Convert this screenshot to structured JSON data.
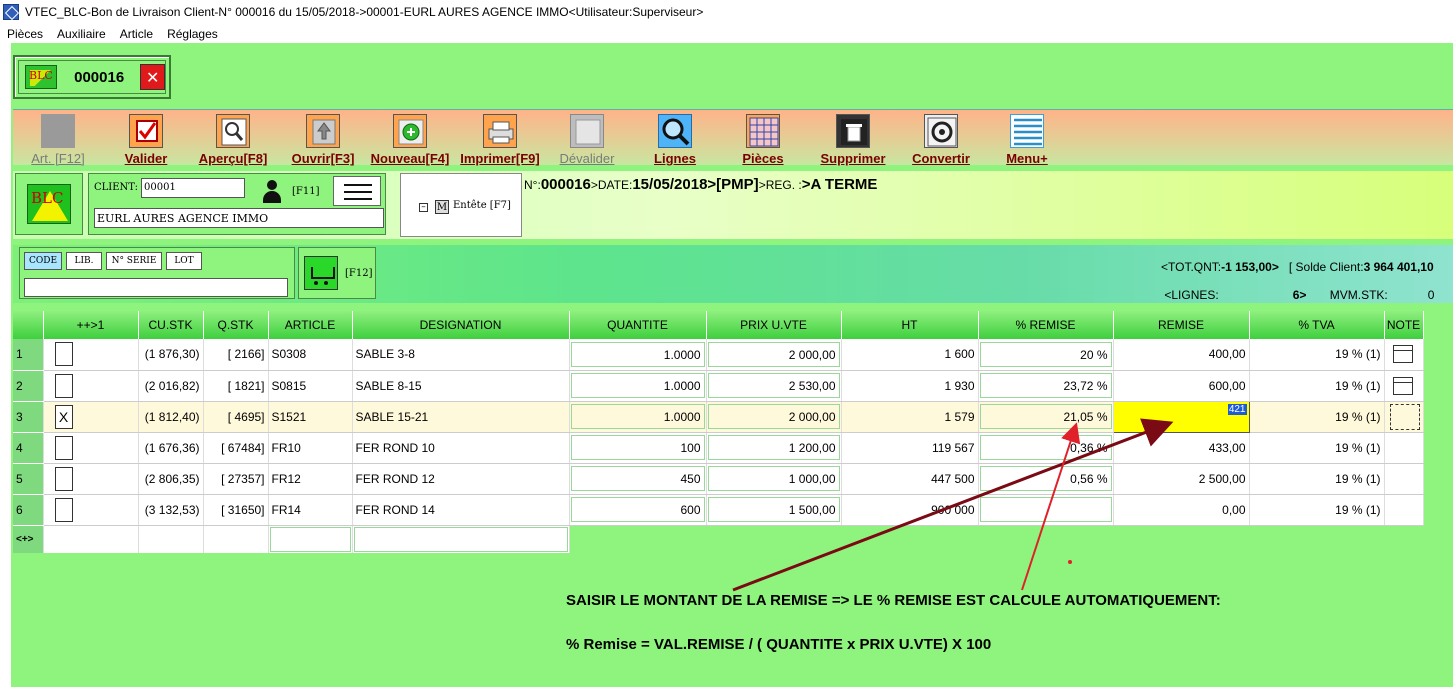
{
  "window": {
    "title": "VTEC_BLC-Bon de Livraison Client-N° 000016 du 15/05/2018->00001-EURL AURES AGENCE IMMO<Utilisateur:Superviseur>"
  },
  "menu": [
    "Pièces",
    "Auxiliaire",
    "Article",
    "Réglages"
  ],
  "doc_tab": {
    "logo_text": "BLC",
    "number": "000016",
    "close": "✕"
  },
  "toolbar": [
    {
      "label": "Art. [F12]",
      "icon": "grey-square-icon",
      "disabled": true
    },
    {
      "label": "Valider",
      "icon": "checkmark-icon",
      "disabled": false
    },
    {
      "label": "Aperçu[F8]",
      "icon": "magnifier-doc-icon",
      "disabled": false
    },
    {
      "label": "Ouvrir[F3]",
      "icon": "up-arrow-icon",
      "disabled": false
    },
    {
      "label": "Nouveau[F4]",
      "icon": "plus-circle-icon",
      "disabled": false
    },
    {
      "label": "Imprimer[F9]",
      "icon": "printer-icon",
      "disabled": false
    },
    {
      "label": "Dévalider",
      "icon": "grey-square-icon",
      "disabled": true
    },
    {
      "label": "Lignes",
      "icon": "search-icon",
      "disabled": false
    },
    {
      "label": "Pièces",
      "icon": "grid-icon",
      "disabled": false
    },
    {
      "label": "Supprimer",
      "icon": "trash-icon",
      "disabled": false
    },
    {
      "label": "Convertir",
      "icon": "convert-gear-icon",
      "disabled": false
    },
    {
      "label": "Menu+",
      "icon": "hamburger-icon",
      "disabled": false
    }
  ],
  "client": {
    "logo_text": "BLC",
    "label": "CLIENT:",
    "code": "00001",
    "name": "EURL AURES AGENCE IMMO",
    "shortcut": "[F11]",
    "entete_m": "M",
    "entete_label": "Entête [F7]"
  },
  "header_info": {
    "n_prefix": "N°:",
    "number": "000016",
    "date_prefix": ">DATE:",
    "date": "15/05/2018",
    "pmp": ">[PMP]",
    "reg_prefix": ">REG. :",
    "reg": ">A TERME"
  },
  "search": {
    "tabs": [
      "CODE",
      "LIB.",
      "N° SERIE",
      "LOT"
    ],
    "input_value": "",
    "cart_shortcut": "[F12]"
  },
  "totals": {
    "tot_qnt_label": "<TOT.QNT:",
    "tot_qnt_value": "-1 153,00>",
    "solde_label": "[ Solde Client:",
    "solde_value": "3 964 401,10",
    "lignes_label": "<LIGNES:",
    "lignes_value": "6>",
    "mvm_label": "MVM.STK:",
    "mvm_value": "0"
  },
  "table": {
    "columns": [
      "",
      "++>1",
      "CU.STK",
      "Q.STK",
      "ARTICLE",
      "DESIGNATION",
      "QUANTITE",
      "PRIX U.VTE",
      "HT",
      "% REMISE",
      "REMISE",
      "% TVA",
      "NOTE"
    ],
    "rows": [
      {
        "n": "1",
        "check": "",
        "cu_stk": "(1 876,30)",
        "q_stk": "[ 2166]",
        "article": "S0308",
        "designation": "SABLE 3-8",
        "quantite": "1.0000",
        "prix": "2 000,00",
        "ht": "1 600",
        "pct_remise": "20 %",
        "remise": "400,00",
        "tva": "19 % (1)",
        "note": "icon"
      },
      {
        "n": "2",
        "check": "",
        "cu_stk": "(2 016,82)",
        "q_stk": "[ 1821]",
        "article": "S0815",
        "designation": "SABLE 8-15",
        "quantite": "1.0000",
        "prix": "2 530,00",
        "ht": "1 930",
        "pct_remise": "23,72 %",
        "remise": "600,00",
        "tva": "19 % (1)",
        "note": "icon"
      },
      {
        "n": "3",
        "check": "X",
        "cu_stk": "(1 812,40)",
        "q_stk": "[ 4695]",
        "article": "S1521",
        "designation": "SABLE 15-21",
        "quantite": "1.0000",
        "prix": "2 000,00",
        "ht": "1 579",
        "pct_remise": "21,05 %",
        "remise": "421",
        "tva": "19 % (1)",
        "note": "dotted"
      },
      {
        "n": "4",
        "check": "",
        "cu_stk": "(1 676,36)",
        "q_stk": "[ 67484]",
        "article": "FR10",
        "designation": "FER ROND 10",
        "quantite": "100",
        "prix": "1 200,00",
        "ht": "119 567",
        "pct_remise": "0,36 %",
        "remise": "433,00",
        "tva": "19 % (1)",
        "note": ""
      },
      {
        "n": "5",
        "check": "",
        "cu_stk": "(2 806,35)",
        "q_stk": "[ 27357]",
        "article": "FR12",
        "designation": "FER ROND 12",
        "quantite": "450",
        "prix": "1 000,00",
        "ht": "447 500",
        "pct_remise": "0,56 %",
        "remise": "2 500,00",
        "tva": "19 % (1)",
        "note": ""
      },
      {
        "n": "6",
        "check": "",
        "cu_stk": "(3 132,53)",
        "q_stk": "[ 31650]",
        "article": "FR14",
        "designation": "FER ROND 14",
        "quantite": "600",
        "prix": "1 500,00",
        "ht": "900 000",
        "pct_remise": "",
        "remise": "0,00",
        "tva": "19 % (1)",
        "note": ""
      }
    ],
    "footer_label": "<+>"
  },
  "annotation": {
    "line1": "SAISIR LE MONTANT DE LA  REMISE => LE % REMISE  EST CALCULE AUTOMATIQUEMENT:",
    "line2": "% Remise = VAL.REMISE / ( QUANTITE x PRIX U.VTE) X 100"
  },
  "colors": {
    "panel_green": "#8ef47e",
    "arrow_dark_red": "#7a0a14",
    "arrow_red": "#e0202a",
    "highlight_yellow": "#ffff00"
  }
}
